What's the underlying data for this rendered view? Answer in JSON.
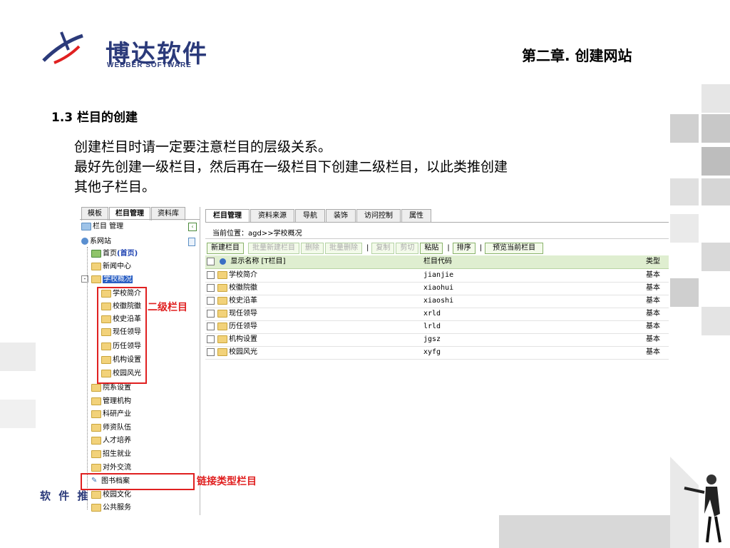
{
  "logo": {
    "cn": "博达软件",
    "en": "WEBBER SOFTWARE"
  },
  "chapter_title": "第二章. 创建网站",
  "section_title": "1.3 栏目的创建",
  "paragraph": {
    "line1": "创建栏目时请一定要注意栏目的层级关系。",
    "line2": "最好先创建一级栏目，然后再在一级栏目下创建二级栏目，以此类推创建",
    "line3": "其他子栏目。"
  },
  "left_panel": {
    "tabs": [
      "模板",
      "栏目管理",
      "资料库"
    ],
    "header": "栏目 管理",
    "root": "系网站",
    "items": [
      {
        "label": "首页",
        "extra": "(首页)"
      },
      {
        "label": "新闻中心"
      },
      {
        "label": "学校概况"
      },
      {
        "label": "学校简介"
      },
      {
        "label": "校徽院徽"
      },
      {
        "label": "校史沿革"
      },
      {
        "label": "现任领导"
      },
      {
        "label": "历任领导"
      },
      {
        "label": "机构设置"
      },
      {
        "label": "校园风光"
      },
      {
        "label": "院系设置"
      },
      {
        "label": "管理机构"
      },
      {
        "label": "科研产业"
      },
      {
        "label": "师资队伍"
      },
      {
        "label": "人才培养"
      },
      {
        "label": "招生就业"
      },
      {
        "label": "对外交流"
      },
      {
        "label": "图书档案"
      },
      {
        "label": "校园文化"
      },
      {
        "label": "公共服务"
      }
    ]
  },
  "annotations": {
    "second_level": "二级栏目",
    "link_type": "链接类型栏目"
  },
  "right_panel": {
    "tabs": [
      "栏目管理",
      "资料来源",
      "导航",
      "装饰",
      "访问控制",
      "属性"
    ],
    "location": "当前位置：agd>>学校概况",
    "toolbar": [
      "新建栏目",
      "批量新建栏目",
      "删除",
      "批量删除",
      "复制",
      "剪切",
      "粘贴",
      "排序",
      "预览当前栏目"
    ],
    "columns": [
      "显示名称 [T栏目]",
      "栏目代码",
      "类型"
    ],
    "rows": [
      {
        "name": "学校简介",
        "code": "jianjie",
        "type": "基本"
      },
      {
        "name": "校徽院徽",
        "code": "xiaohui",
        "type": "基本"
      },
      {
        "name": "校史沿革",
        "code": "xiaoshi",
        "type": "基本"
      },
      {
        "name": "现任领导",
        "code": "xrld",
        "type": "基本"
      },
      {
        "name": "历任领导",
        "code": "lrld",
        "type": "基本"
      },
      {
        "name": "机构设置",
        "code": "jgsz",
        "type": "基本"
      },
      {
        "name": "校园风光",
        "code": "xyfg",
        "type": "基本"
      }
    ]
  },
  "footer_text": "软 件 推",
  "colors": {
    "accent_red": "#e02020",
    "logo_blue": "#2b3a7a",
    "toolbar_green": "#8ab36b"
  }
}
